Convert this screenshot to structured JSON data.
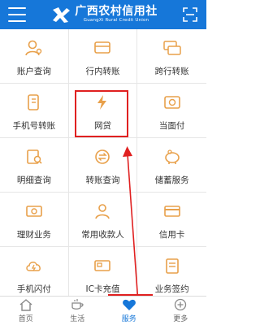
{
  "header": {
    "title_cn": "广西农村信用社",
    "title_en": "GuangXi Rural Credit Union"
  },
  "colors": {
    "brand_blue": "#1677d9",
    "icon_orange": "#e8a04a",
    "highlight_red": "#e02020"
  },
  "services": [
    {
      "label": "账户查询",
      "icon": "user-search-icon"
    },
    {
      "label": "行内转账",
      "icon": "transfer-cards-icon"
    },
    {
      "label": "跨行转账",
      "icon": "interbank-cards-icon"
    },
    {
      "label": "手机号转账",
      "icon": "phone-transfer-icon"
    },
    {
      "label": "网贷",
      "icon": "lightning-icon"
    },
    {
      "label": "当面付",
      "icon": "face-pay-icon"
    },
    {
      "label": "明细查询",
      "icon": "detail-search-icon"
    },
    {
      "label": "转账查询",
      "icon": "transfer-search-icon"
    },
    {
      "label": "储蓄服务",
      "icon": "piggy-bank-icon"
    },
    {
      "label": "理财业务",
      "icon": "wealth-icon"
    },
    {
      "label": "常用收款人",
      "icon": "payee-icon"
    },
    {
      "label": "信用卡",
      "icon": "credit-card-icon"
    },
    {
      "label": "手机闪付",
      "icon": "quickpay-cloud-icon"
    },
    {
      "label": "IC卡充值",
      "icon": "ic-card-icon"
    },
    {
      "label": "业务签约",
      "icon": "sign-contract-icon"
    }
  ],
  "tabs": [
    {
      "label": "首页",
      "icon": "home-icon"
    },
    {
      "label": "生活",
      "icon": "coffee-icon"
    },
    {
      "label": "服务",
      "icon": "heart-icon"
    },
    {
      "label": "更多",
      "icon": "plus-circle-icon"
    }
  ],
  "active_tab": "服务"
}
